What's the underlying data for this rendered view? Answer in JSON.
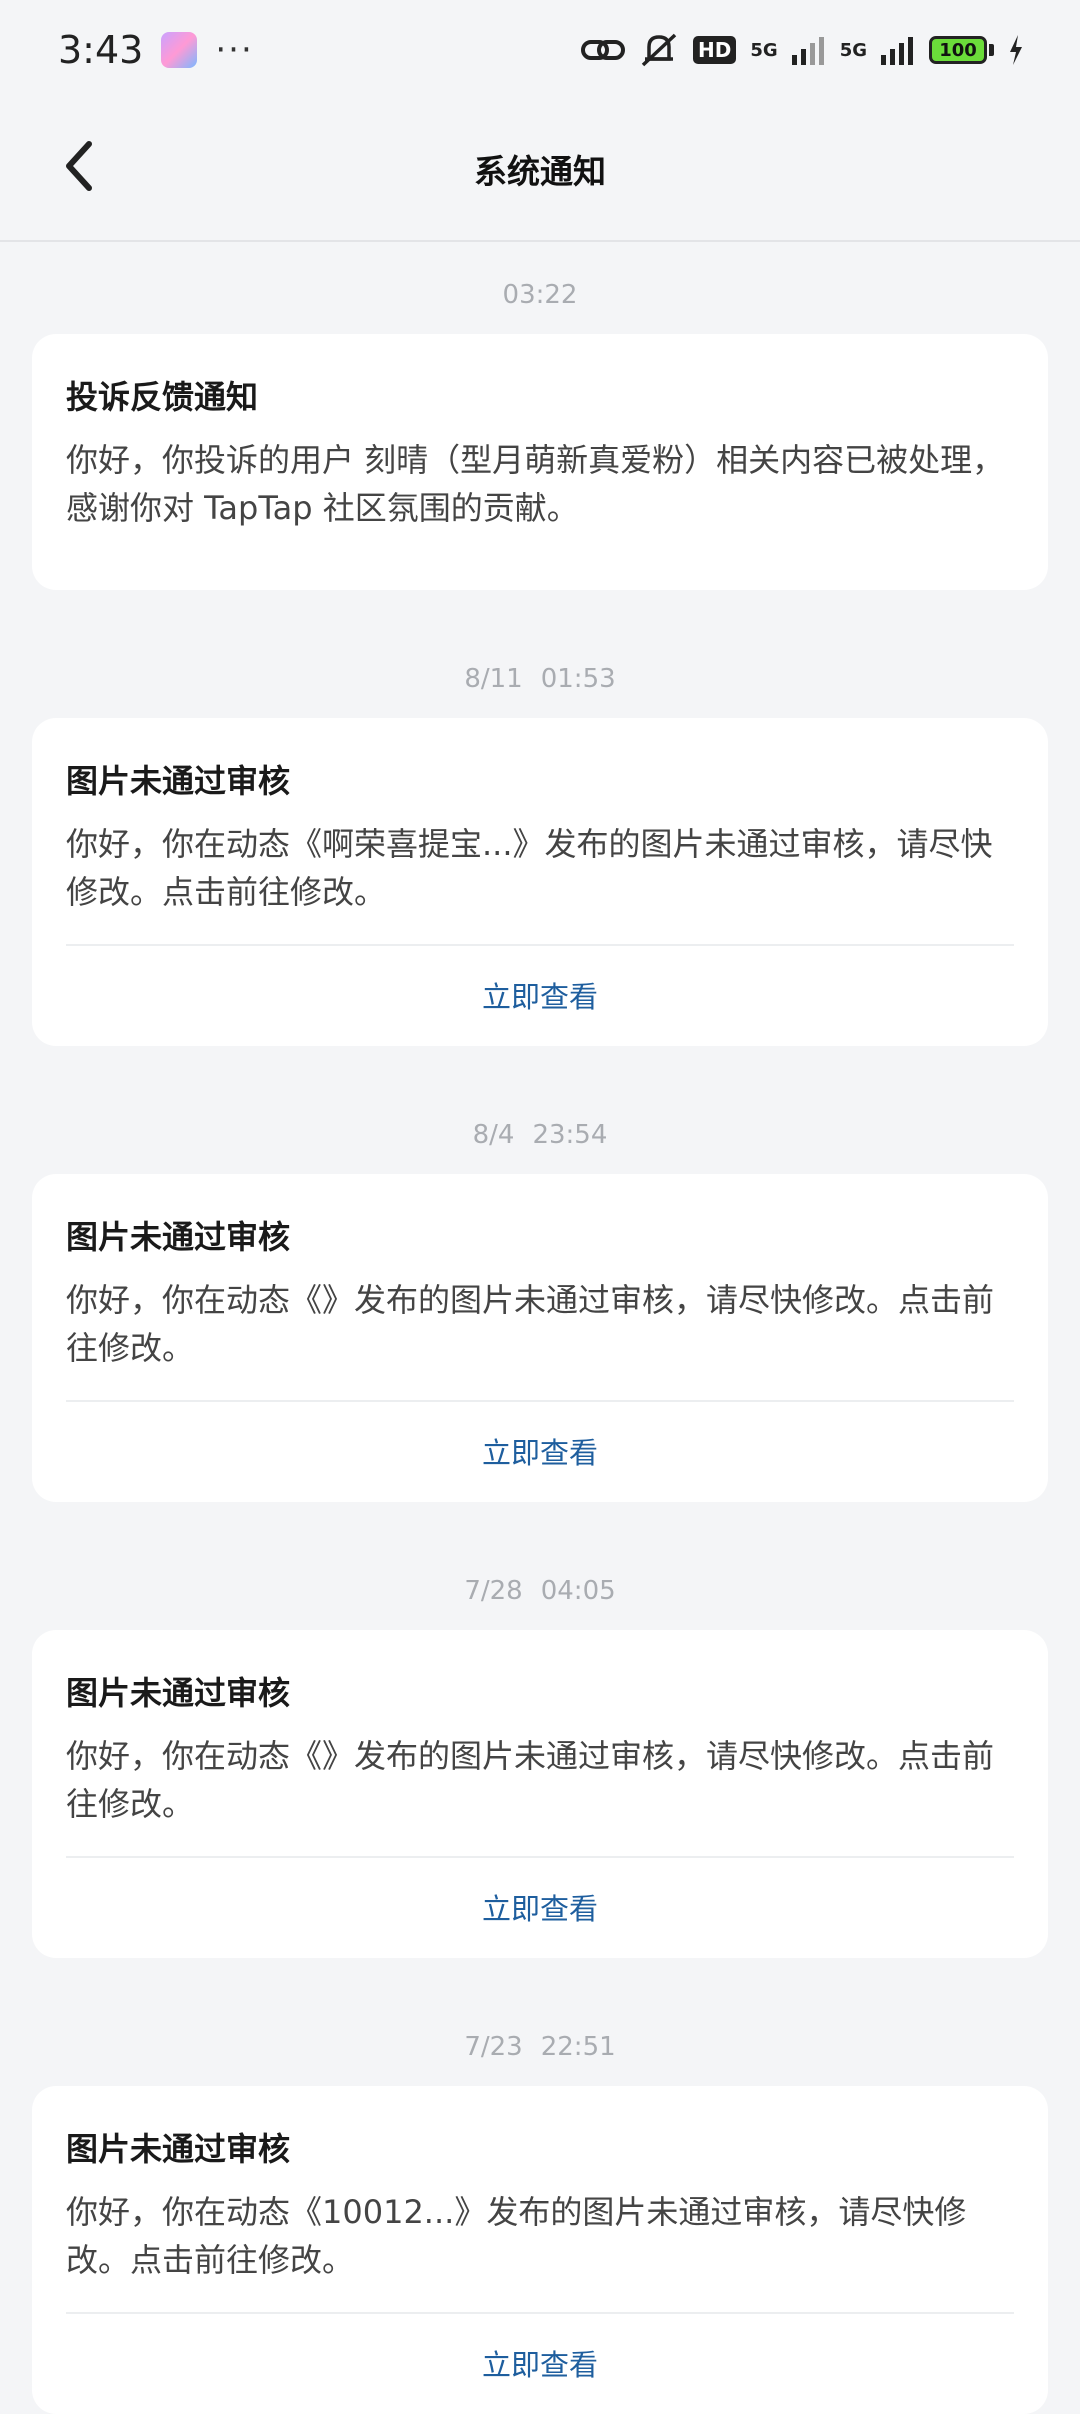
{
  "status": {
    "time": "3:43",
    "dots": "···",
    "hd": "HD",
    "net1": "5G",
    "net2": "5G",
    "battery": "100"
  },
  "header": {
    "title": "系统通知"
  },
  "notices": [
    {
      "time": "03:22",
      "date": "",
      "title": "投诉反馈通知",
      "body": "你好，你投诉的用户 刻晴（型月萌新真爱粉）相关内容已被处理，感谢你对 TapTap 社区氛围的贡献。",
      "action": ""
    },
    {
      "date": "8/11",
      "time": "01:53",
      "title": "图片未通过审核",
      "body": "你好，你在动态《啊荣喜提宝...》发布的图片未通过审核，请尽快修改。点击前往修改。",
      "action": "立即查看"
    },
    {
      "date": "8/4",
      "time": "23:54",
      "title": "图片未通过审核",
      "body": "你好，你在动态《》发布的图片未通过审核，请尽快修改。点击前往修改。",
      "action": "立即查看"
    },
    {
      "date": "7/28",
      "time": "04:05",
      "title": "图片未通过审核",
      "body": "你好，你在动态《》发布的图片未通过审核，请尽快修改。点击前往修改。",
      "action": "立即查看"
    },
    {
      "date": "7/23",
      "time": "22:51",
      "title": "图片未通过审核",
      "body": "你好，你在动态《10012...》发布的图片未通过审核，请尽快修改。点击前往修改。",
      "action": "立即查看"
    }
  ],
  "colors": {
    "background": "#f4f5f7",
    "card": "#ffffff",
    "link": "#1e5e9e",
    "timestamp": "#a9acb1"
  }
}
